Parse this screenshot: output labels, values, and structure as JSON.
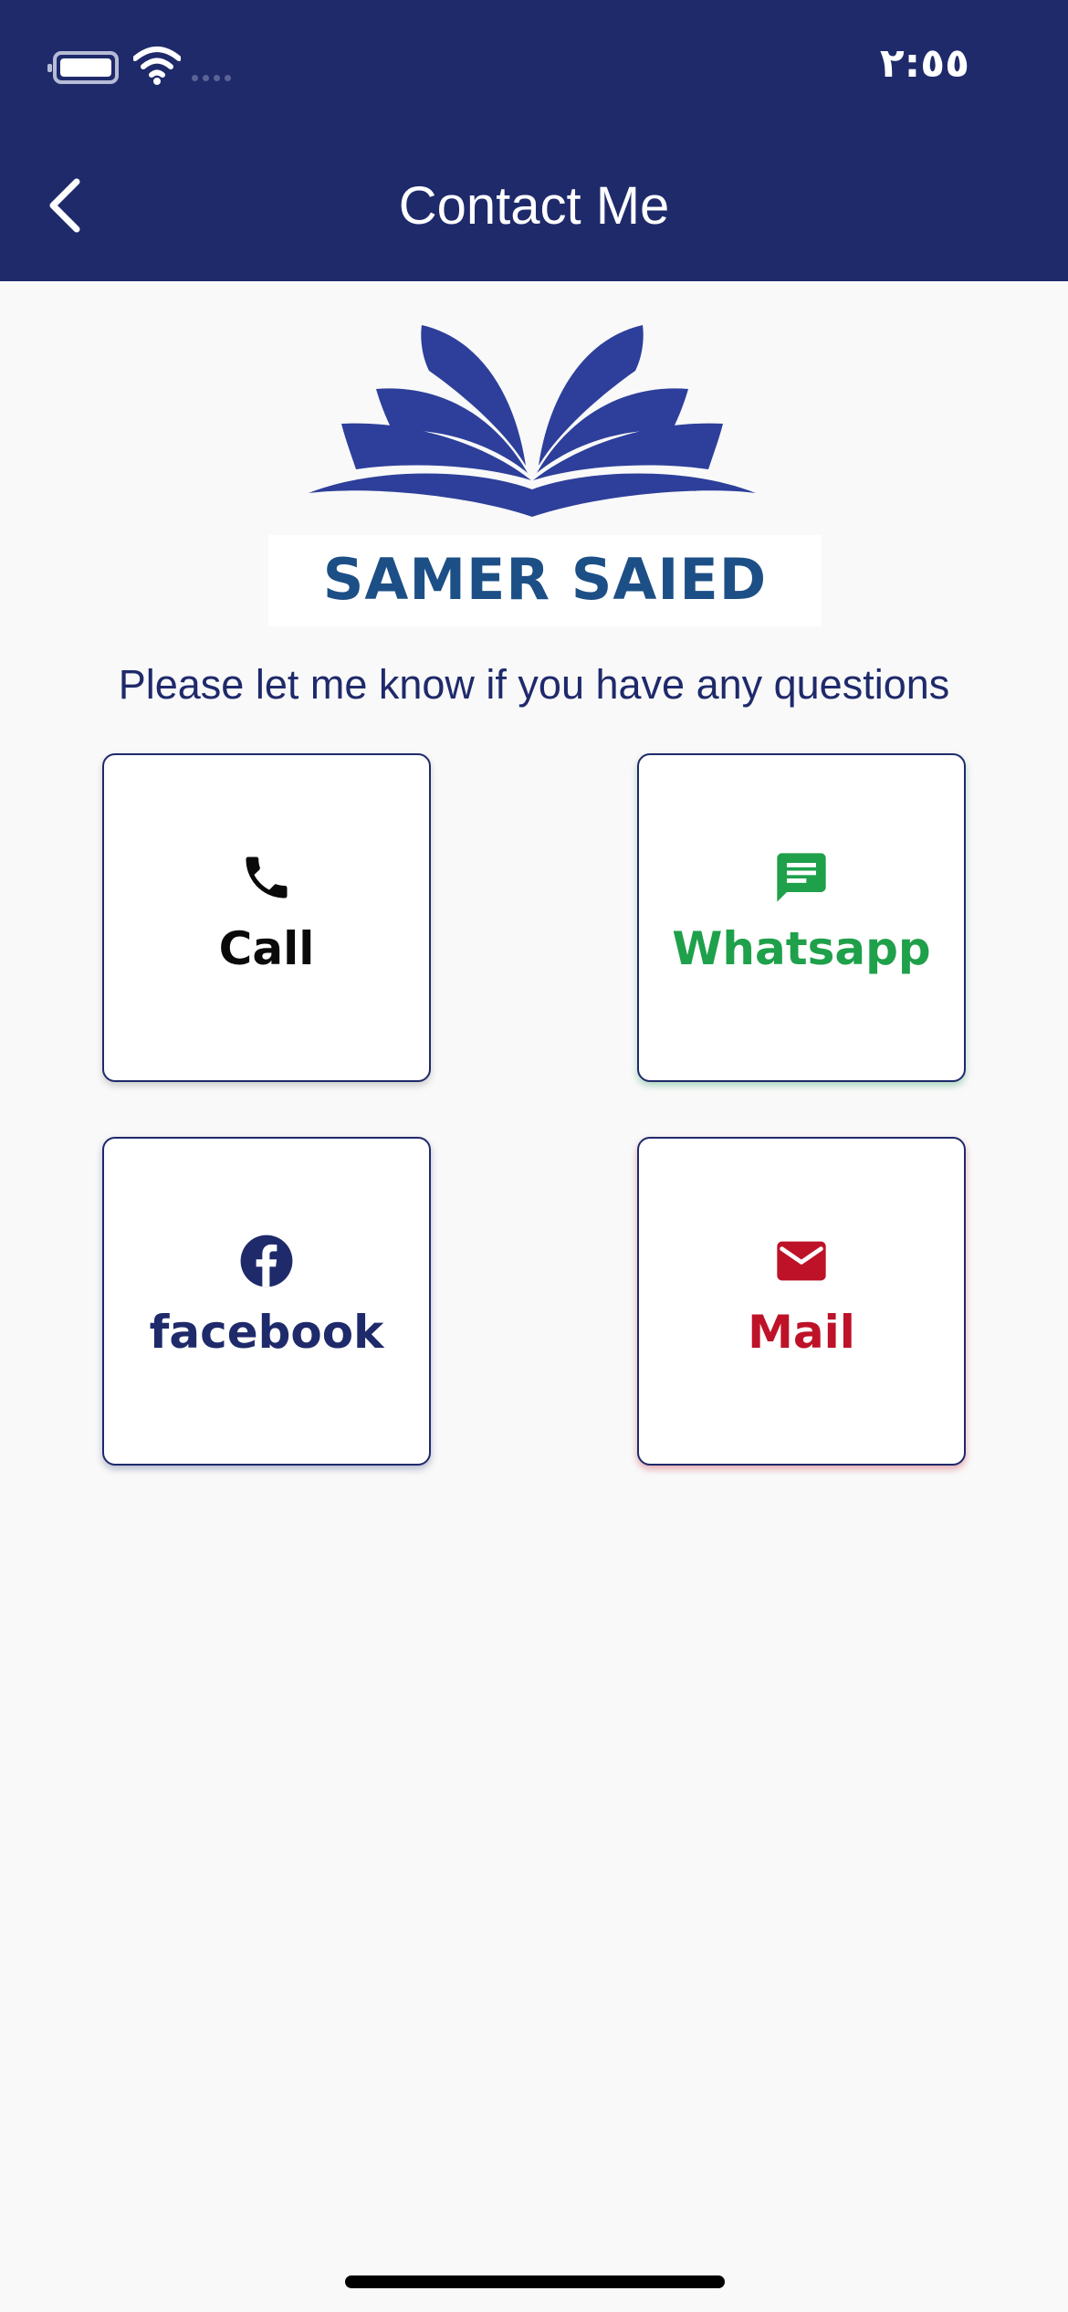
{
  "status_bar": {
    "time": "٢:٥٥",
    "icons": [
      "battery-icon",
      "wifi-icon",
      "signal-icon"
    ]
  },
  "header": {
    "title": "Contact Me",
    "back_icon": "chevron-left-icon",
    "background_color": "#1f2a6b"
  },
  "logo": {
    "text": "SAMER SAIED",
    "icon": "open-book-icon",
    "color": "#2d3f9a"
  },
  "subtitle": "Please let me know if you have any questions",
  "contact_options": {
    "call": {
      "label": "Call",
      "icon": "phone-icon",
      "color": "#0a0a0a"
    },
    "whatsapp": {
      "label": "Whatsapp",
      "icon": "chat-message-icon",
      "color": "#1fa04a"
    },
    "facebook": {
      "label": "facebook",
      "icon": "facebook-icon",
      "color": "#1f2a6b"
    },
    "mail": {
      "label": "Mail",
      "icon": "envelope-icon",
      "color": "#be1228"
    }
  }
}
